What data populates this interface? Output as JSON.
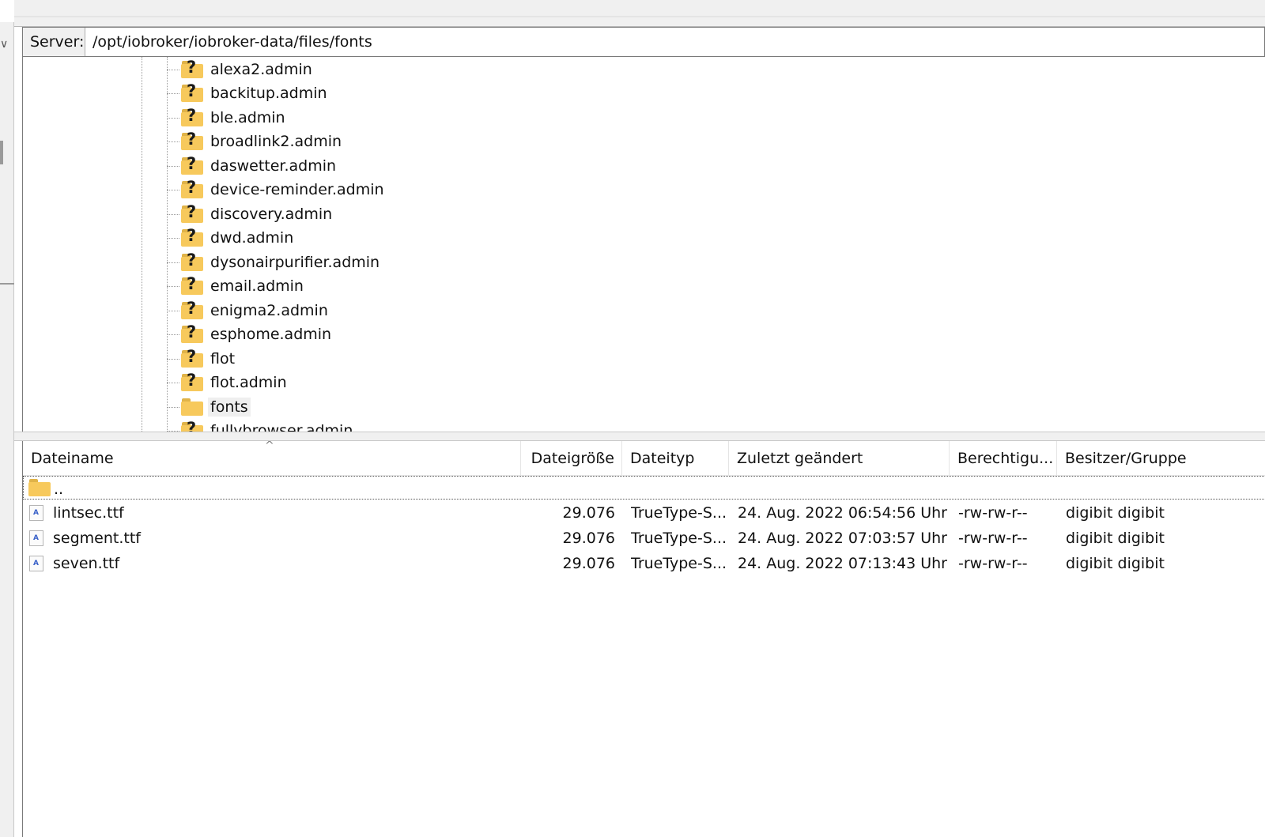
{
  "server": {
    "label": "Server:",
    "path": "/opt/iobroker/iobroker-data/files/fonts"
  },
  "tree": {
    "items": [
      {
        "label": "alexa2.admin",
        "icon": "question-folder-icon"
      },
      {
        "label": "backitup.admin",
        "icon": "question-folder-icon"
      },
      {
        "label": "ble.admin",
        "icon": "question-folder-icon"
      },
      {
        "label": "broadlink2.admin",
        "icon": "question-folder-icon"
      },
      {
        "label": "daswetter.admin",
        "icon": "question-folder-icon"
      },
      {
        "label": "device-reminder.admin",
        "icon": "question-folder-icon"
      },
      {
        "label": "discovery.admin",
        "icon": "question-folder-icon"
      },
      {
        "label": "dwd.admin",
        "icon": "question-folder-icon"
      },
      {
        "label": "dysonairpurifier.admin",
        "icon": "question-folder-icon"
      },
      {
        "label": "email.admin",
        "icon": "question-folder-icon"
      },
      {
        "label": "enigma2.admin",
        "icon": "question-folder-icon"
      },
      {
        "label": "esphome.admin",
        "icon": "question-folder-icon"
      },
      {
        "label": "flot",
        "icon": "question-folder-icon"
      },
      {
        "label": "flot.admin",
        "icon": "question-folder-icon"
      },
      {
        "label": "fonts",
        "icon": "folder-icon",
        "selected": true
      },
      {
        "label": "fullybrowser.admin",
        "icon": "question-folder-icon"
      }
    ]
  },
  "list": {
    "columns": [
      "Dateiname",
      "Dateigröße",
      "Dateityp",
      "Zuletzt geändert",
      "Berechtigu...",
      "Besitzer/Gruppe"
    ],
    "parent_label": "..",
    "rows": [
      {
        "name": "lintsec.ttf",
        "size": "29.076",
        "type": "TrueType-S...",
        "modified": "24. Aug. 2022 06:54:56 Uhr",
        "perms": "-rw-rw-r--",
        "owner": "digibit digibit"
      },
      {
        "name": "segment.ttf",
        "size": "29.076",
        "type": "TrueType-S...",
        "modified": "24. Aug. 2022 07:03:57 Uhr",
        "perms": "-rw-rw-r--",
        "owner": "digibit digibit"
      },
      {
        "name": "seven.ttf",
        "size": "29.076",
        "type": "TrueType-S...",
        "modified": "24. Aug. 2022 07:13:43 Uhr",
        "perms": "-rw-rw-r--",
        "owner": "digibit digibit"
      }
    ]
  },
  "colors": {
    "folder": "#f7c95c",
    "folder_tab": "#e0b348",
    "border": "#7a7a7a",
    "chrome": "#f0f0f0"
  }
}
